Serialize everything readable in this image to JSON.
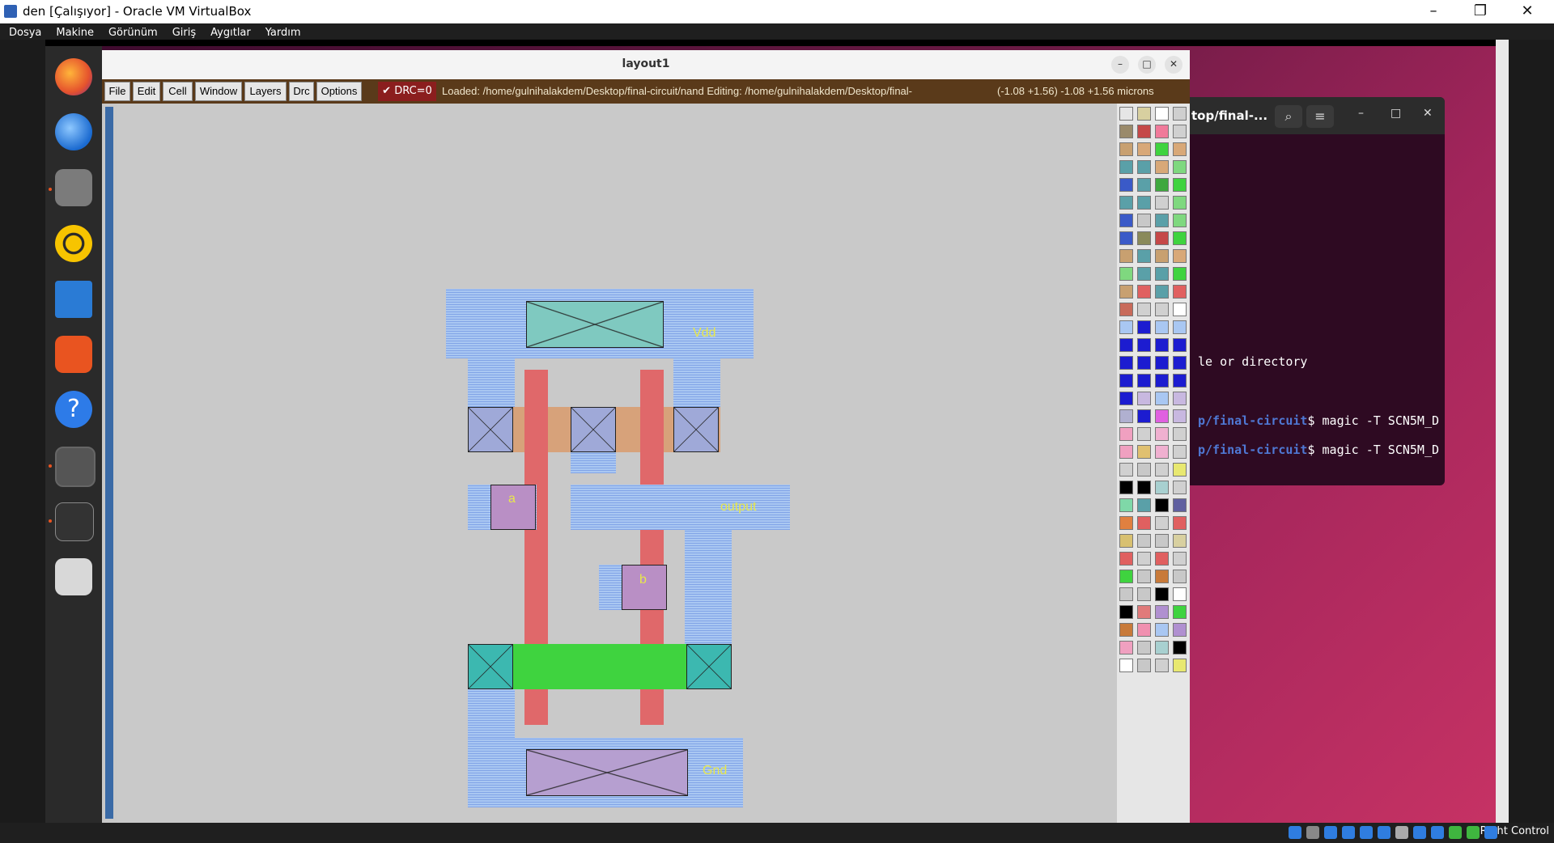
{
  "host_window": {
    "title": "den [Çalışıyor] - Oracle VM VirtualBox",
    "controls": [
      "–",
      "❐",
      "✕"
    ],
    "menu": [
      "Dosya",
      "Makine",
      "Görünüm",
      "Giriş",
      "Aygıtlar",
      "Yardım"
    ],
    "status_right": "Right Control"
  },
  "dock": {
    "items": [
      "firefox-icon",
      "thunderbird-icon",
      "files-icon",
      "rhythmbox-icon",
      "writer-icon",
      "app-center-icon",
      "help-icon",
      "settings-icon",
      "terminal-icon",
      "trash-icon"
    ]
  },
  "terminal": {
    "title": "top/final-...",
    "lines": [
      {
        "prompt": "",
        "text": "le or directory"
      },
      {
        "prompt": "p/final-circuit",
        "text": "$ magic -T SCN5M_D"
      },
      {
        "prompt": "p/final-circuit",
        "text": "$ magic -T SCN5M_D"
      }
    ]
  },
  "magic": {
    "title": "layout1",
    "menu": [
      "File",
      "Edit",
      "Cell",
      "Window",
      "Layers",
      "Drc",
      "Options"
    ],
    "drc": "DRC=0",
    "status": "Loaded: /home/gulnihalakdem/Desktop/final-circuit/nand Editing: /home/gulnihalakdem/Desktop/final-",
    "coords": "(-1.08 +1.56) -1.08 +1.56 microns",
    "labels": {
      "vdd": "Vdd",
      "gnd": "Gnd",
      "output": "output",
      "a": "a",
      "b": "b"
    }
  }
}
